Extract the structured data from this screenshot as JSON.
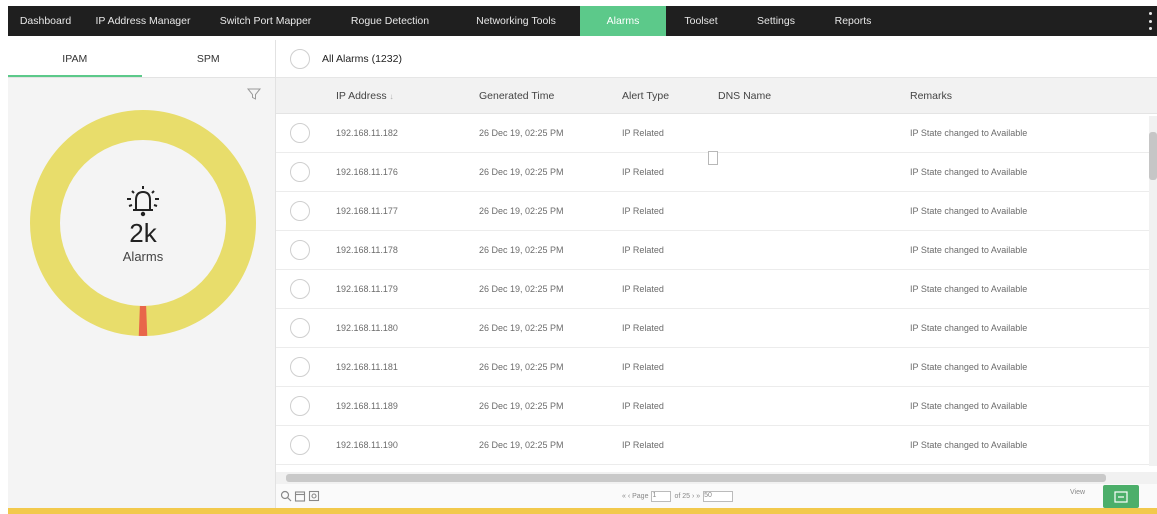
{
  "nav": {
    "items": [
      {
        "label": "Dashboard",
        "active": false
      },
      {
        "label": "IP Address Manager",
        "active": false
      },
      {
        "label": "Switch Port Mapper",
        "active": false
      },
      {
        "label": "Rogue Detection",
        "active": false
      },
      {
        "label": "Networking Tools",
        "active": false
      },
      {
        "label": "Alarms",
        "active": true
      },
      {
        "label": "Toolset",
        "active": false
      },
      {
        "label": "Settings",
        "active": false
      },
      {
        "label": "Reports",
        "active": false
      }
    ],
    "more_icon": "kebab-menu-icon",
    "active_color": "#5cc98a"
  },
  "left_panel": {
    "tabs": [
      {
        "label": "IPAM",
        "active": true
      },
      {
        "label": "SPM",
        "active": false
      }
    ],
    "filter_icon": "filter-icon",
    "donut": {
      "count": "2k",
      "label": "Alarms",
      "icon": "bell-alert-icon",
      "main_color": "#e8dd6b",
      "minor_color": "#e8664a",
      "minor_fraction": 0.012
    }
  },
  "main": {
    "title": "All Alarms (1232)",
    "columns": [
      "IP Address",
      "Generated Time",
      "Alert Type",
      "DNS Name",
      "Remarks"
    ],
    "sort_indicator": "↓",
    "rows": [
      {
        "ip": "192.168.11.182",
        "time": "26 Dec 19, 02:25 PM",
        "type": "IP Related",
        "dns": "",
        "remarks": "IP State changed to Available"
      },
      {
        "ip": "192.168.11.176",
        "time": "26 Dec 19, 02:25 PM",
        "type": "IP Related",
        "dns": "",
        "remarks": "IP State changed to Available"
      },
      {
        "ip": "192.168.11.177",
        "time": "26 Dec 19, 02:25 PM",
        "type": "IP Related",
        "dns": "",
        "remarks": "IP State changed to Available"
      },
      {
        "ip": "192.168.11.178",
        "time": "26 Dec 19, 02:25 PM",
        "type": "IP Related",
        "dns": "",
        "remarks": "IP State changed to Available"
      },
      {
        "ip": "192.168.11.179",
        "time": "26 Dec 19, 02:25 PM",
        "type": "IP Related",
        "dns": "",
        "remarks": "IP State changed to Available"
      },
      {
        "ip": "192.168.11.180",
        "time": "26 Dec 19, 02:25 PM",
        "type": "IP Related",
        "dns": "",
        "remarks": "IP State changed to Available"
      },
      {
        "ip": "192.168.11.181",
        "time": "26 Dec 19, 02:25 PM",
        "type": "IP Related",
        "dns": "",
        "remarks": "IP State changed to Available"
      },
      {
        "ip": "192.168.11.189",
        "time": "26 Dec 19, 02:25 PM",
        "type": "IP Related",
        "dns": "",
        "remarks": "IP State changed to Available"
      },
      {
        "ip": "192.168.11.190",
        "time": "26 Dec 19, 02:25 PM",
        "type": "IP Related",
        "dns": "",
        "remarks": "IP State changed to Available"
      }
    ],
    "footer": {
      "icons": [
        "search-icon",
        "calendar-icon",
        "settings-icon"
      ],
      "pager_prefix": "« ‹ Page",
      "page_value": "1",
      "pager_suffix": "of 25 › »",
      "page_size": "50",
      "view_text": "View",
      "export_icon": "export-icon",
      "export_color": "#4caf6a"
    }
  },
  "bottom_bar_color": "#f2c94c"
}
